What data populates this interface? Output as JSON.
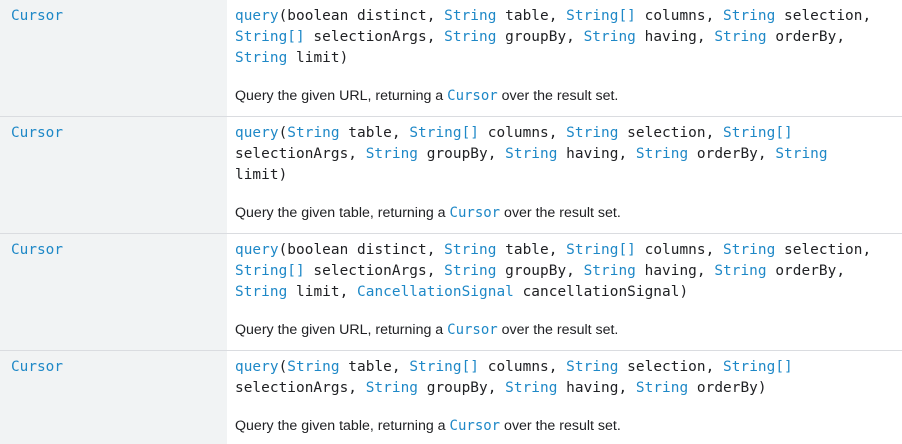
{
  "rows": [
    {
      "return_type": "Cursor",
      "method": "query",
      "lines": [
        [
          [
            "p",
            "("
          ],
          [
            "t",
            "boolean"
          ],
          [
            "p",
            " distinct, "
          ],
          [
            "l",
            "String"
          ],
          [
            "p",
            " table, "
          ],
          [
            "l",
            "String[]"
          ],
          [
            "p",
            " columns, "
          ],
          [
            "l",
            "String"
          ],
          [
            "p",
            " selection,"
          ]
        ],
        [
          [
            "l",
            "String[]"
          ],
          [
            "p",
            " selectionArgs, "
          ],
          [
            "l",
            "String"
          ],
          [
            "p",
            " groupBy, "
          ],
          [
            "l",
            "String"
          ],
          [
            "p",
            " having, "
          ],
          [
            "l",
            "String"
          ],
          [
            "p",
            " orderBy,"
          ]
        ],
        [
          [
            "l",
            "String"
          ],
          [
            "p",
            " limit)"
          ]
        ]
      ],
      "desc_before": "Query the given URL, returning a ",
      "desc_link": "Cursor",
      "desc_after": " over the result set."
    },
    {
      "return_type": "Cursor",
      "method": "query",
      "lines": [
        [
          [
            "p",
            "("
          ],
          [
            "l",
            "String"
          ],
          [
            "p",
            " table, "
          ],
          [
            "l",
            "String[]"
          ],
          [
            "p",
            " columns, "
          ],
          [
            "l",
            "String"
          ],
          [
            "p",
            " selection, "
          ],
          [
            "l",
            "String[]"
          ]
        ],
        [
          [
            "p",
            "selectionArgs, "
          ],
          [
            "l",
            "String"
          ],
          [
            "p",
            " groupBy, "
          ],
          [
            "l",
            "String"
          ],
          [
            "p",
            " having, "
          ],
          [
            "l",
            "String"
          ],
          [
            "p",
            " orderBy, "
          ],
          [
            "l",
            "String"
          ]
        ],
        [
          [
            "p",
            "limit)"
          ]
        ]
      ],
      "desc_before": "Query the given table, returning a ",
      "desc_link": "Cursor",
      "desc_after": " over the result set."
    },
    {
      "return_type": "Cursor",
      "method": "query",
      "lines": [
        [
          [
            "p",
            "("
          ],
          [
            "t",
            "boolean"
          ],
          [
            "p",
            " distinct, "
          ],
          [
            "l",
            "String"
          ],
          [
            "p",
            " table, "
          ],
          [
            "l",
            "String[]"
          ],
          [
            "p",
            " columns, "
          ],
          [
            "l",
            "String"
          ],
          [
            "p",
            " selection,"
          ]
        ],
        [
          [
            "l",
            "String[]"
          ],
          [
            "p",
            " selectionArgs, "
          ],
          [
            "l",
            "String"
          ],
          [
            "p",
            " groupBy, "
          ],
          [
            "l",
            "String"
          ],
          [
            "p",
            " having, "
          ],
          [
            "l",
            "String"
          ],
          [
            "p",
            " orderBy,"
          ]
        ],
        [
          [
            "l",
            "String"
          ],
          [
            "p",
            " limit, "
          ],
          [
            "l",
            "CancellationSignal"
          ],
          [
            "p",
            " cancellationSignal)"
          ]
        ]
      ],
      "desc_before": "Query the given URL, returning a ",
      "desc_link": "Cursor",
      "desc_after": " over the result set."
    },
    {
      "return_type": "Cursor",
      "method": "query",
      "lines": [
        [
          [
            "p",
            "("
          ],
          [
            "l",
            "String"
          ],
          [
            "p",
            " table, "
          ],
          [
            "l",
            "String[]"
          ],
          [
            "p",
            " columns, "
          ],
          [
            "l",
            "String"
          ],
          [
            "p",
            " selection, "
          ],
          [
            "l",
            "String[]"
          ]
        ],
        [
          [
            "p",
            "selectionArgs, "
          ],
          [
            "l",
            "String"
          ],
          [
            "p",
            " groupBy, "
          ],
          [
            "l",
            "String"
          ],
          [
            "p",
            " having, "
          ],
          [
            "l",
            "String"
          ],
          [
            "p",
            " orderBy)"
          ]
        ]
      ],
      "desc_before": "Query the given table, returning a ",
      "desc_link": "Cursor",
      "desc_after": " over the result set."
    }
  ]
}
